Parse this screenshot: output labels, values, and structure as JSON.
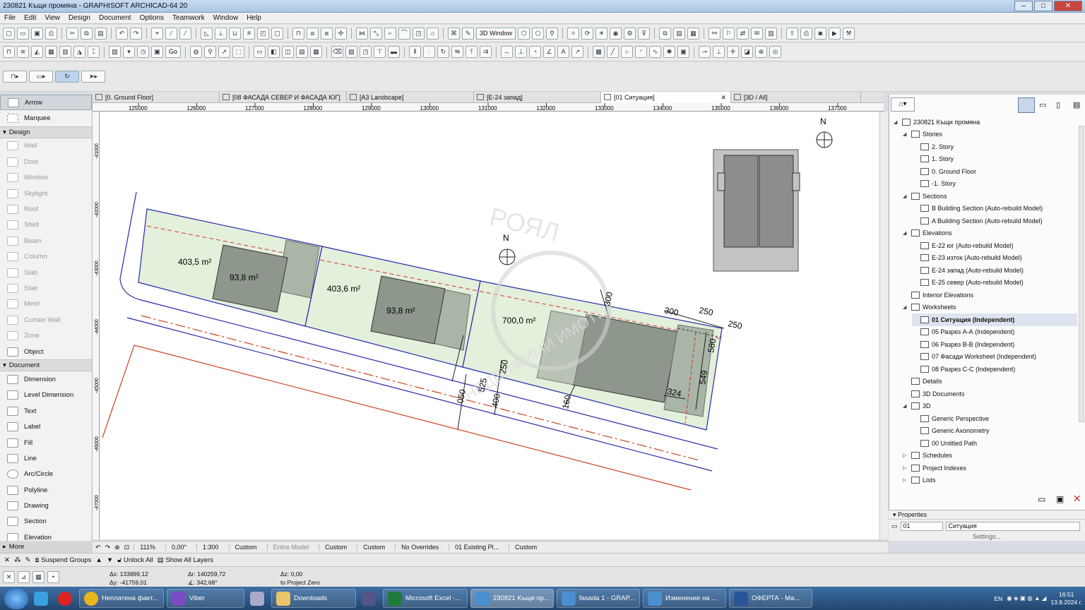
{
  "window": {
    "title": "230821 Къщи промяна - GRAPHISOFT ARCHICAD-64 20"
  },
  "menu": [
    "File",
    "Edit",
    "View",
    "Design",
    "Document",
    "Options",
    "Teamwork",
    "Window",
    "Help"
  ],
  "toolbar": {
    "window3d_label": "3D Window",
    "go_label": "Go"
  },
  "toolbox": {
    "arrow": "Arrow",
    "marquee": "Marquee",
    "design_header": "Design",
    "design_tools": [
      "Wall",
      "Door",
      "Window",
      "Skylight",
      "Roof",
      "Shell",
      "Beam",
      "Column",
      "Slab",
      "Stair",
      "Mesh",
      "Curtain Wall",
      "Zone",
      "Object"
    ],
    "document_header": "Document",
    "document_tools": [
      "Dimension",
      "Level Dimension",
      "Text",
      "Label",
      "Fill",
      "Line",
      "Arc/Circle",
      "Polyline",
      "Drawing",
      "Section",
      "Elevation"
    ],
    "more": "More"
  },
  "tabs": [
    "[0. Ground Floor]",
    "[08 ФАСАДА СЕВЕР И ФАСАДА ЮГ]",
    "[A3 Landscape]",
    "[E-24 запад]",
    "[01 Ситуация]",
    "[3D / All]"
  ],
  "ruler_h": [
    "125000",
    "126000",
    "127000",
    "128000",
    "129000",
    "130000",
    "131000",
    "132000",
    "133000",
    "134000",
    "135000",
    "136000",
    "137000"
  ],
  "ruler_v": [
    "-41000",
    "-42000",
    "-43000",
    "-44000",
    "-45000",
    "-46000",
    "-47000"
  ],
  "drawing": {
    "north_label": "N",
    "area_labels": [
      "403,5 m²",
      "93,8 m²",
      "403,6 m²",
      "93,8 m²",
      "700,0 m²"
    ],
    "dimensions": [
      "300",
      "250",
      "250",
      "580",
      "549",
      "324",
      "160",
      "300",
      "250",
      "525",
      "400",
      "050"
    ],
    "watermark_top": "РОЯЛ",
    "watermark_bottom": "НЕДВИЖИМИ ИМОТИ"
  },
  "navigator": {
    "items": [
      {
        "label": "230821 Къщи промяна",
        "level": 0,
        "tri": "◢"
      },
      {
        "label": "Stories",
        "level": 1,
        "tri": "◢"
      },
      {
        "label": "2. Story",
        "level": 2,
        "tri": ""
      },
      {
        "label": "1. Story",
        "level": 2,
        "tri": ""
      },
      {
        "label": "0. Ground Floor",
        "level": 2,
        "tri": ""
      },
      {
        "label": "-1. Story",
        "level": 2,
        "tri": ""
      },
      {
        "label": "Sections",
        "level": 1,
        "tri": "◢"
      },
      {
        "label": "B Building Section (Auto-rebuild Model)",
        "level": 2,
        "tri": ""
      },
      {
        "label": "A Building Section (Auto-rebuild Model)",
        "level": 2,
        "tri": ""
      },
      {
        "label": "Elevations",
        "level": 1,
        "tri": "◢"
      },
      {
        "label": "E-22 юг (Auto-rebuild Model)",
        "level": 2,
        "tri": ""
      },
      {
        "label": "E-23 изток (Auto-rebuild Model)",
        "level": 2,
        "tri": ""
      },
      {
        "label": "E-24 запад (Auto-rebuild Model)",
        "level": 2,
        "tri": ""
      },
      {
        "label": "E-25 север (Auto-rebuild Model)",
        "level": 2,
        "tri": ""
      },
      {
        "label": "Interior Elevations",
        "level": 1,
        "tri": ""
      },
      {
        "label": "Worksheets",
        "level": 1,
        "tri": "◢"
      },
      {
        "label": "01 Ситуация (Independent)",
        "level": 2,
        "tri": "",
        "selected": true
      },
      {
        "label": "05 Разрез А-А (Independent)",
        "level": 2,
        "tri": ""
      },
      {
        "label": "06 Разрез B-B (Independent)",
        "level": 2,
        "tri": ""
      },
      {
        "label": "07 Фасади Worksheet (Independent)",
        "level": 2,
        "tri": ""
      },
      {
        "label": "08 Разрез C-C (Independent)",
        "level": 2,
        "tri": ""
      },
      {
        "label": "Details",
        "level": 1,
        "tri": ""
      },
      {
        "label": "3D Documents",
        "level": 1,
        "tri": ""
      },
      {
        "label": "3D",
        "level": 1,
        "tri": "◢"
      },
      {
        "label": "Generic Perspective",
        "level": 2,
        "tri": ""
      },
      {
        "label": "Generic Axonometry",
        "level": 2,
        "tri": ""
      },
      {
        "label": "00 Untitled Path",
        "level": 2,
        "tri": ""
      },
      {
        "label": "Schedules",
        "level": 1,
        "tri": "▷"
      },
      {
        "label": "Project Indexes",
        "level": 1,
        "tri": "▷"
      },
      {
        "label": "Lists",
        "level": 1,
        "tri": "▷"
      }
    ]
  },
  "properties": {
    "header": "Properties",
    "id": "01",
    "name": "Ситуация",
    "settings": "Settings..."
  },
  "statusbar": {
    "zoom": "111%",
    "angle": "0,00°",
    "scale": "1:300",
    "layer_combo": "Custom",
    "model": "Entire Model",
    "pen_set": "Custom",
    "model_view": "Custom",
    "overrides": "No Overrides",
    "renovation": "01 Existing Pl...",
    "dim": "Custom"
  },
  "layerbar": {
    "suspend": "Suspend Groups",
    "unlock": "Unlock All",
    "show_layers": "Show All Layers"
  },
  "coords": {
    "ax": "Δx: 133899,12",
    "ay": "Δy: -41759,01",
    "ar": "Δr: 140259,72",
    "aang": "∡: 342,68°",
    "az": "Δz: 0,00",
    "zref": "to Project Zero"
  },
  "taskbar": {
    "items": [
      "Неплатена факт...",
      "Viber",
      "Downloads",
      "Microsoft Excel -...",
      "230821 Къщи пр...",
      "fasada 1 - GRAP...",
      "Изменение на ...",
      "ОФЕРТА - Ма..."
    ],
    "lang": "EN",
    "time": "16:51",
    "date": "13.8.2024 г."
  }
}
